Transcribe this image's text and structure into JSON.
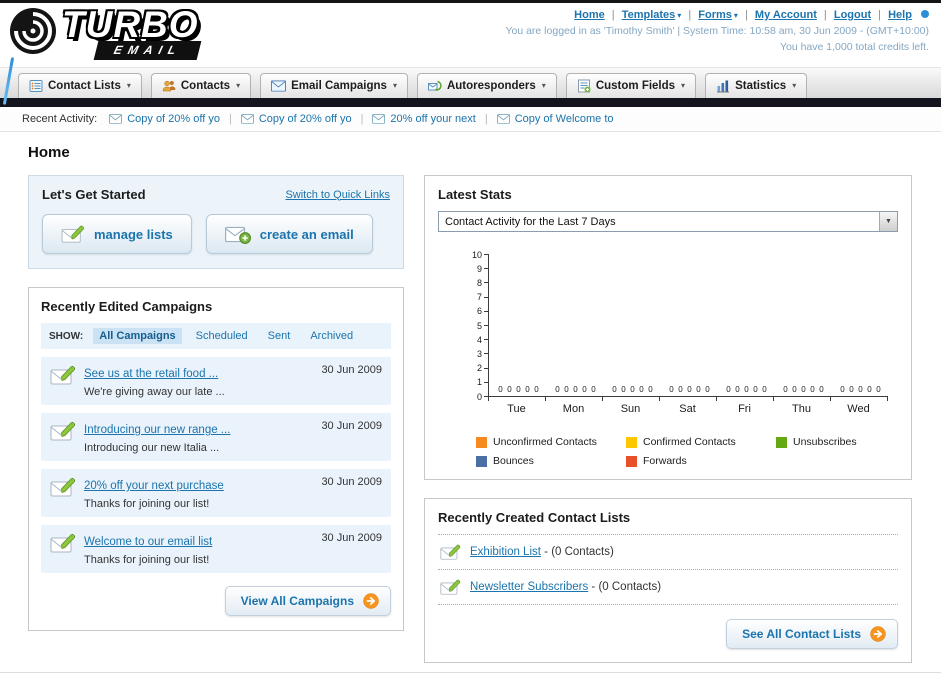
{
  "colors": {
    "link_blue": "#1b74ad",
    "accent_orange": "#f7941e",
    "dark_bar": "#14141f",
    "panel_blue_bg": "#eaf3fb"
  },
  "icons": {
    "caret_down": "▾",
    "separator": "|",
    "select_arrow": "▼"
  },
  "header": {
    "logo_main": "TURBO",
    "logo_sub": "EMAIL",
    "links": [
      {
        "label": "Home",
        "dropdown": false
      },
      {
        "label": "Templates",
        "dropdown": true
      },
      {
        "label": "Forms",
        "dropdown": true
      },
      {
        "label": "My Account",
        "dropdown": false
      },
      {
        "label": "Logout",
        "dropdown": false
      },
      {
        "label": "Help",
        "dropdown": false
      }
    ],
    "status": "You are logged in as 'Timothy Smith' | System Time: 10:58 am, 30 Jun 2009 - (GMT+10:00)",
    "credits": "You have 1,000 total credits left."
  },
  "nav": {
    "items": [
      {
        "label": "Contact Lists"
      },
      {
        "label": "Contacts"
      },
      {
        "label": "Email Campaigns"
      },
      {
        "label": "Autoresponders"
      },
      {
        "label": "Custom Fields"
      },
      {
        "label": "Statistics"
      }
    ]
  },
  "recent_activity": {
    "label": "Recent Activity:",
    "items": [
      {
        "label": "Copy of 20% off yo"
      },
      {
        "label": "Copy of 20% off yo"
      },
      {
        "label": "20% off your next"
      },
      {
        "label": "Copy of Welcome to"
      }
    ]
  },
  "page": {
    "title": "Home"
  },
  "get_started": {
    "title": "Let's Get Started",
    "switch_link": "Switch to Quick Links",
    "manage_lists_label": "manage lists",
    "create_email_label": "create an email"
  },
  "campaigns": {
    "title": "Recently Edited Campaigns",
    "show_label": "SHOW:",
    "tabs": [
      {
        "label": "All Campaigns",
        "active": true
      },
      {
        "label": "Scheduled",
        "active": false
      },
      {
        "label": "Sent",
        "active": false
      },
      {
        "label": "Archived",
        "active": false
      }
    ],
    "items": [
      {
        "title": "See us at the retail food ...",
        "subtitle": "We're giving away our late ...",
        "date": "30 Jun 2009"
      },
      {
        "title": "Introducing our new range ...",
        "subtitle": "Introducing our new Italia ...",
        "date": "30 Jun 2009"
      },
      {
        "title": "20% off your next purchase",
        "subtitle": "Thanks for joining our list!",
        "date": "30 Jun 2009"
      },
      {
        "title": "Welcome to our email list",
        "subtitle": "Thanks for joining our list!",
        "date": "30 Jun 2009"
      }
    ],
    "view_all_label": "View All Campaigns"
  },
  "stats": {
    "title": "Latest Stats",
    "period_selected": "Contact Activity for the Last 7 Days"
  },
  "chart_data": {
    "type": "bar",
    "title": "Contact Activity for the Last 7 Days",
    "categories": [
      "Tue",
      "Mon",
      "Sun",
      "Sat",
      "Fri",
      "Thu",
      "Wed"
    ],
    "series": [
      {
        "name": "Unconfirmed Contacts",
        "color": "#f6891f",
        "values": [
          0,
          0,
          0,
          0,
          0,
          0,
          0
        ]
      },
      {
        "name": "Confirmed Contacts",
        "color": "#fdc800",
        "values": [
          0,
          0,
          0,
          0,
          0,
          0,
          0
        ]
      },
      {
        "name": "Unsubscribes",
        "color": "#64a812",
        "values": [
          0,
          0,
          0,
          0,
          0,
          0,
          0
        ]
      },
      {
        "name": "Bounces",
        "color": "#4a6fa5",
        "values": [
          0,
          0,
          0,
          0,
          0,
          0,
          0
        ]
      },
      {
        "name": "Forwards",
        "color": "#e8502a",
        "values": [
          0,
          0,
          0,
          0,
          0,
          0,
          0
        ]
      }
    ],
    "xlabel": "",
    "ylabel": "",
    "ylim": [
      0,
      10
    ],
    "yticks": [
      0,
      1,
      2,
      3,
      4,
      5,
      6,
      7,
      8,
      9,
      10
    ],
    "grid": false,
    "legend_position": "bottom"
  },
  "contact_lists": {
    "title": "Recently Created Contact Lists",
    "items": [
      {
        "name": "Exhibition List",
        "count": " - (0 Contacts)"
      },
      {
        "name": "Newsletter Subscribers",
        "count": " - (0 Contacts)"
      }
    ],
    "see_all_label": "See All Contact Lists"
  }
}
